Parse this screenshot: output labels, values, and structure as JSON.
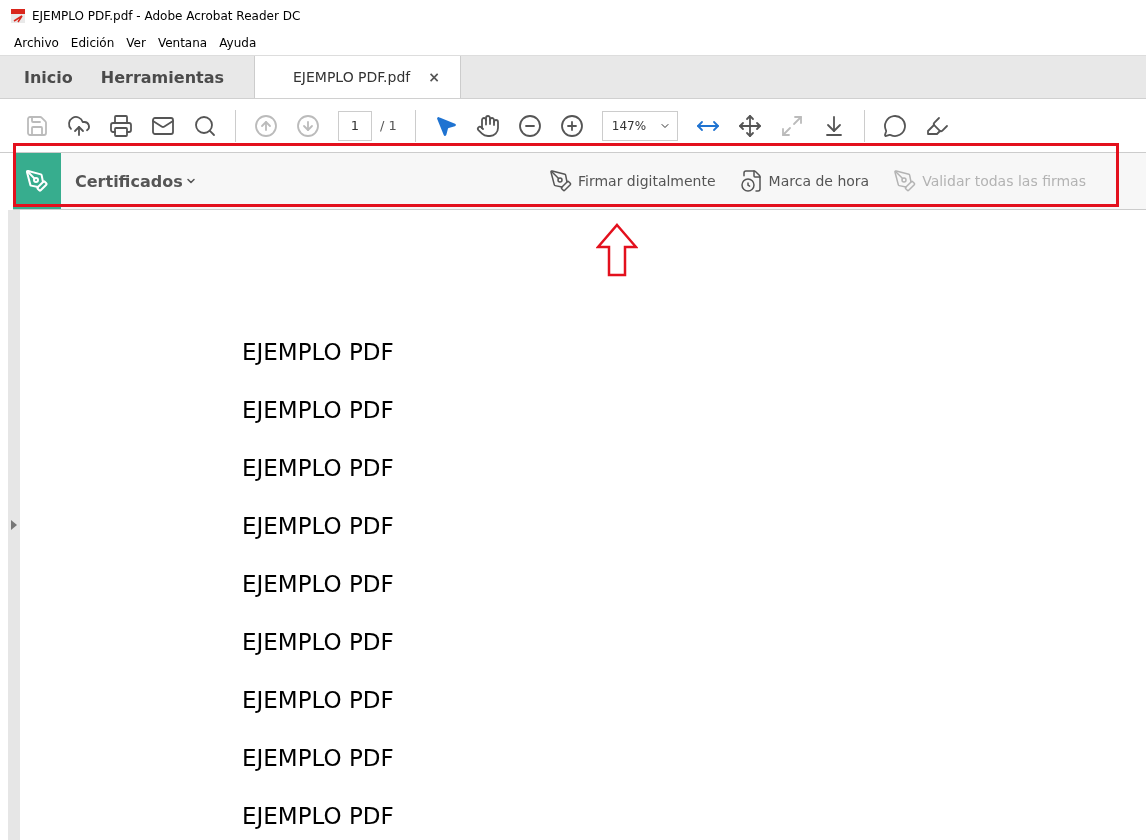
{
  "window": {
    "title": "EJEMPLO PDF.pdf - Adobe Acrobat Reader DC"
  },
  "menu": [
    "Archivo",
    "Edición",
    "Ver",
    "Ventana",
    "Ayuda"
  ],
  "tabs": [
    {
      "label": "Inicio",
      "kind": "nav",
      "selected": false
    },
    {
      "label": "Herramientas",
      "kind": "nav",
      "selected": false
    },
    {
      "label": "EJEMPLO PDF.pdf",
      "kind": "document",
      "selected": true,
      "close": "×"
    }
  ],
  "toolbar": {
    "tools": [
      {
        "kind": "save",
        "disabled": true,
        "selected": false
      },
      {
        "kind": "upload",
        "disabled": false,
        "selected": false
      },
      {
        "kind": "print",
        "disabled": false,
        "selected": false
      },
      {
        "kind": "mail",
        "disabled": false,
        "selected": false
      },
      {
        "kind": "search",
        "disabled": false,
        "selected": false
      },
      {
        "kind": "separator"
      },
      {
        "kind": "prev-page",
        "disabled": true,
        "selected": false
      },
      {
        "kind": "next-page",
        "disabled": true,
        "selected": false
      },
      {
        "kind": "page"
      },
      {
        "kind": "separator"
      },
      {
        "kind": "select",
        "disabled": false,
        "selected": true
      },
      {
        "kind": "hand",
        "disabled": false,
        "selected": false
      },
      {
        "kind": "zoom-out",
        "disabled": false,
        "selected": false
      },
      {
        "kind": "zoom-in",
        "disabled": false,
        "selected": false
      },
      {
        "kind": "zoom"
      },
      {
        "kind": "fit-width",
        "disabled": false,
        "selected": true
      },
      {
        "kind": "fit-page",
        "disabled": false,
        "selected": false
      },
      {
        "kind": "full-screen",
        "disabled": true,
        "selected": false
      },
      {
        "kind": "read-mode",
        "disabled": false,
        "selected": false
      },
      {
        "kind": "separator"
      },
      {
        "kind": "comment",
        "disabled": false,
        "selected": false
      },
      {
        "kind": "highlight",
        "disabled": false,
        "selected": false
      }
    ],
    "page_number": "1",
    "page_total": "/ 1",
    "zoom": "147%"
  },
  "certificates_bar": {
    "title": "Certificados",
    "actions": [
      {
        "label": "Firmar digitalmente",
        "kind": "sign",
        "disabled": false
      },
      {
        "label": "Marca de hora",
        "kind": "timestamp",
        "disabled": false
      },
      {
        "label": "Validar todas las firmas",
        "kind": "validate",
        "disabled": true
      }
    ]
  },
  "document": {
    "lines": [
      "EJEMPLO PDF",
      "EJEMPLO PDF",
      "EJEMPLO PDF",
      "EJEMPLO PDF",
      "EJEMPLO PDF",
      "EJEMPLO PDF",
      "EJEMPLO PDF",
      "EJEMPLO PDF",
      "EJEMPLO PDF"
    ]
  }
}
